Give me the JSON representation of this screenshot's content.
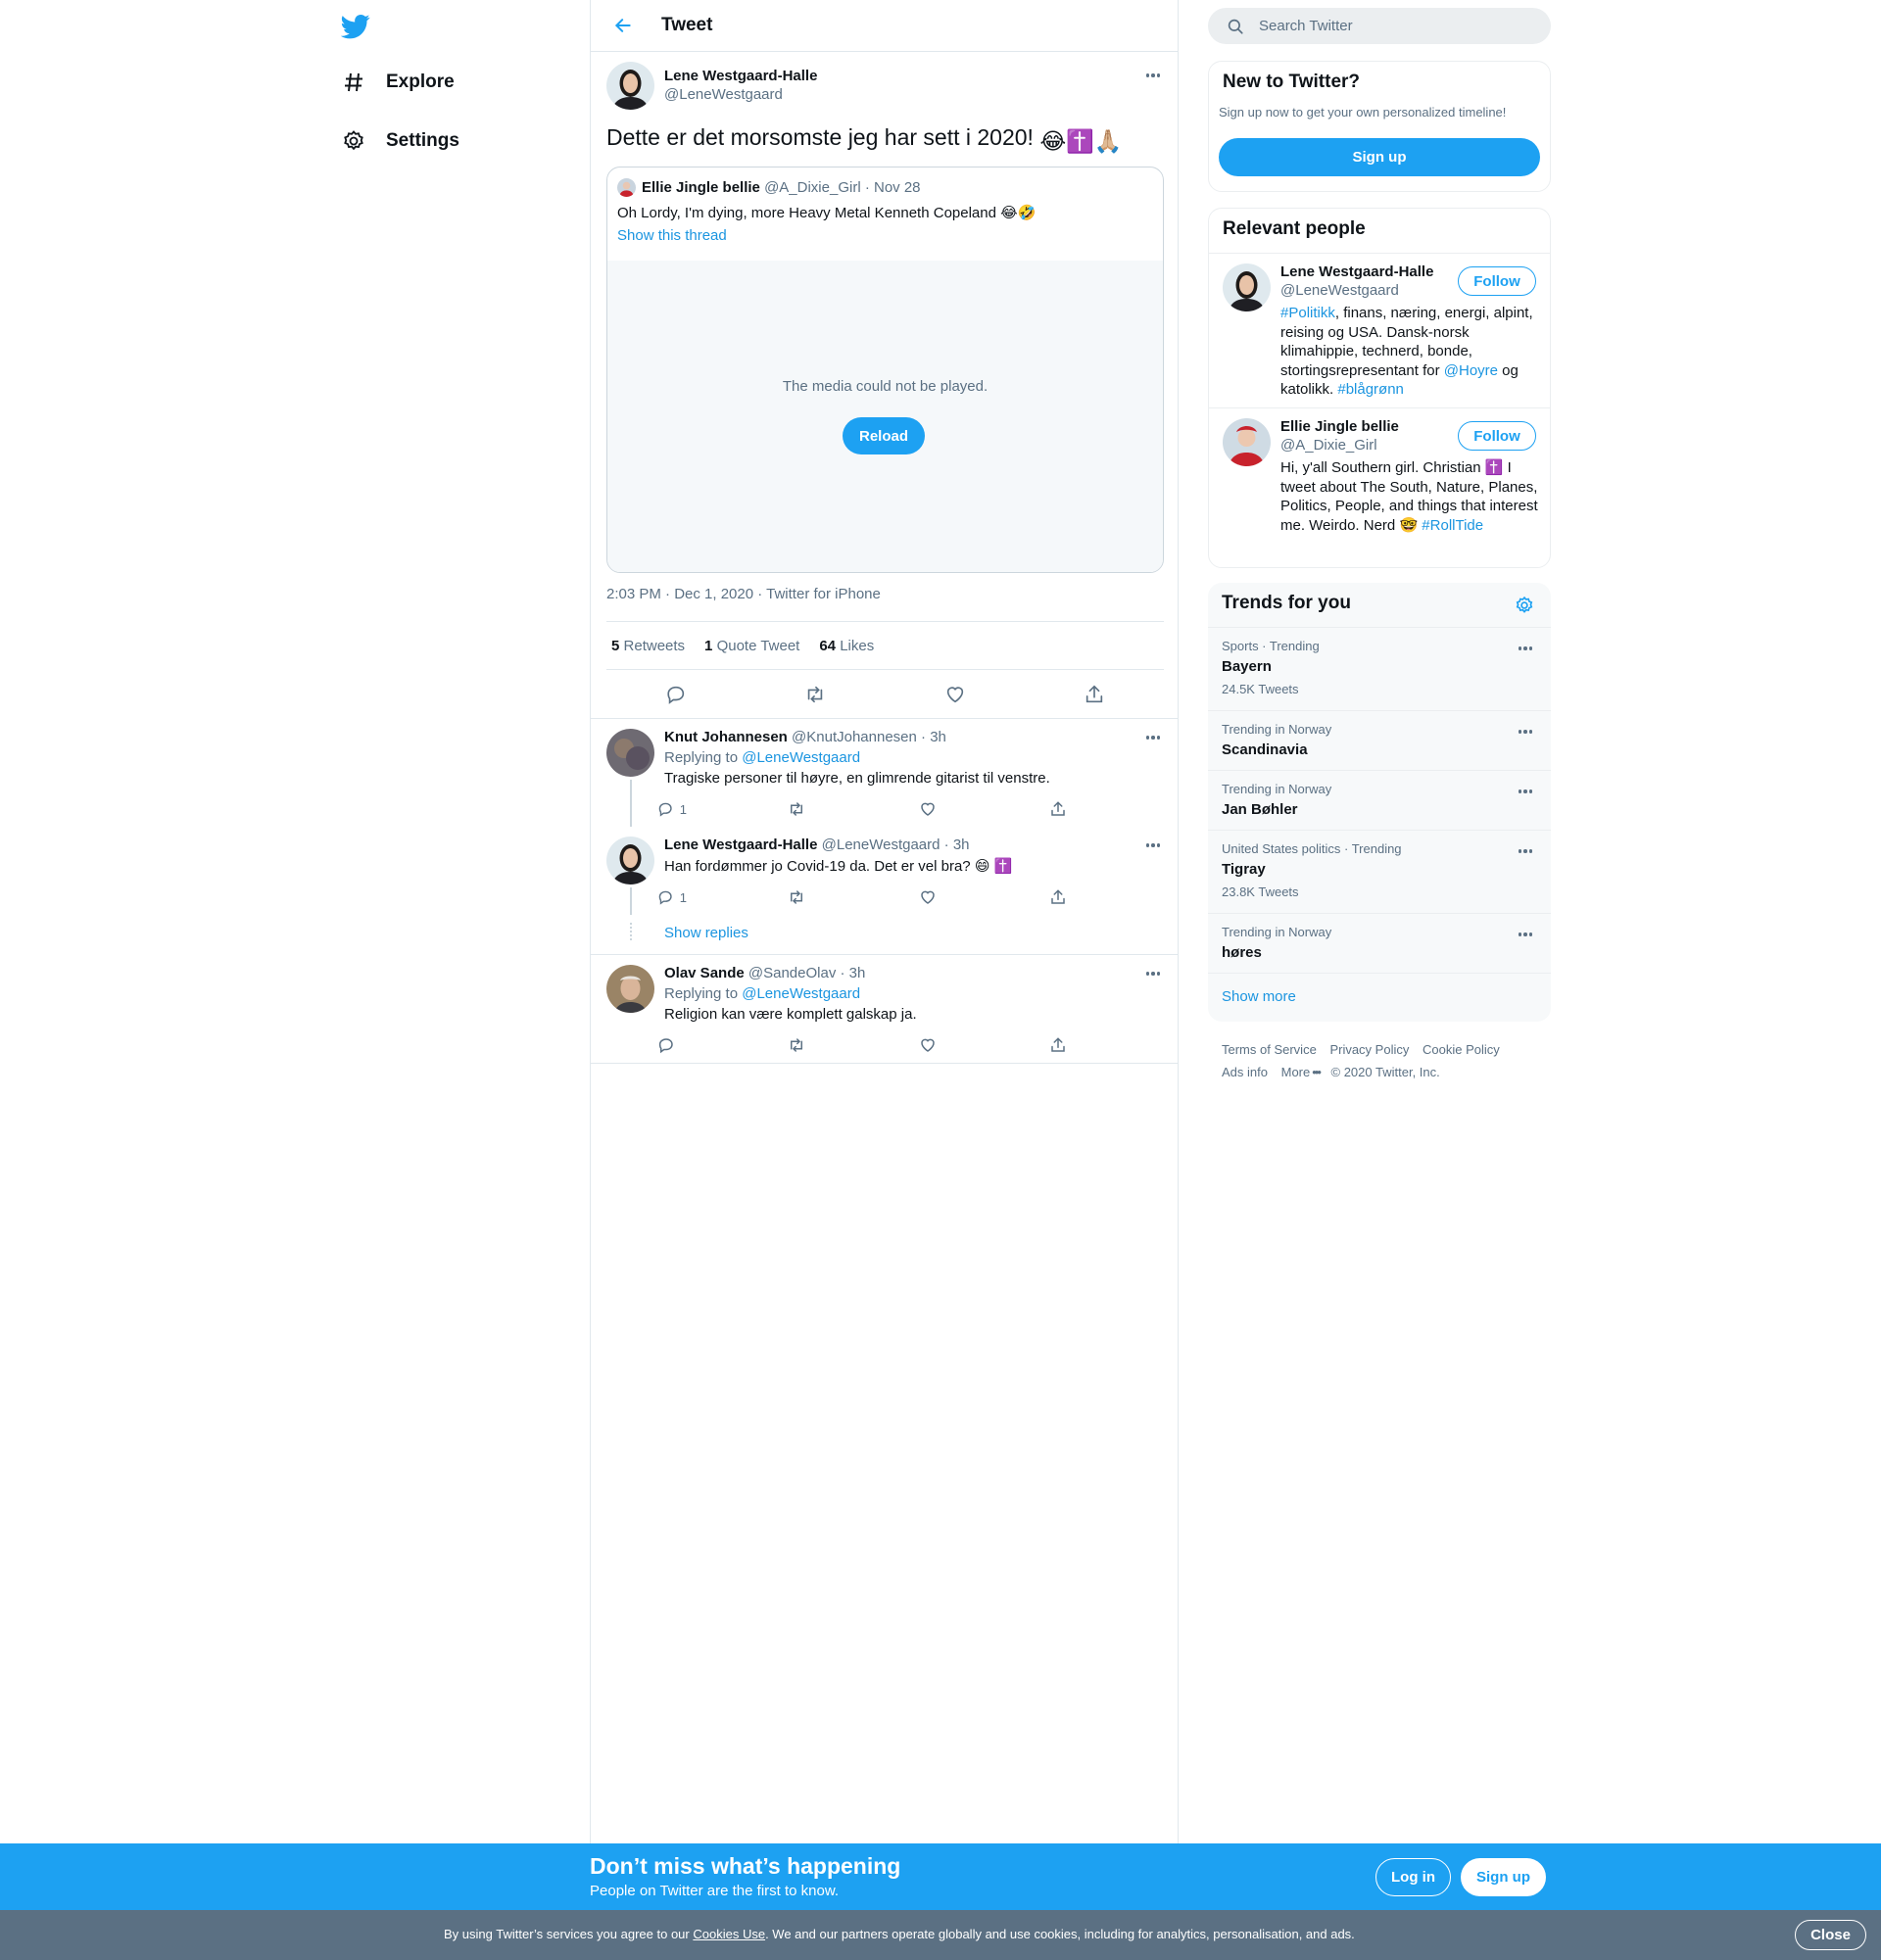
{
  "colors": {
    "accent": "#1da1f2",
    "link": "#1b95e0",
    "muted": "#5b7083",
    "border": "#e1e8ed"
  },
  "nav": {
    "logo_icon": "twitter-bird-icon",
    "items": [
      {
        "label": "Explore",
        "icon": "hashtag-icon"
      },
      {
        "label": "Settings",
        "icon": "gear-icon"
      }
    ]
  },
  "header": {
    "title": "Tweet"
  },
  "tweet": {
    "author_name": "Lene Westgaard-Halle",
    "author_handle": "@LeneWestgaard",
    "text": "Dette er det morsomste jeg har sett i 2020!",
    "text_emojis": [
      "😂",
      "✝️",
      "🙏🏼"
    ],
    "quote": {
      "name": "Ellie Jingle bellie",
      "handle": "@A_Dixie_Girl",
      "date": "· Nov 28",
      "text": "Oh Lordy, I'm dying, more Heavy Metal Kenneth Copeland",
      "text_emojis": [
        "😂",
        "🤣"
      ],
      "thread_link": "Show this thread",
      "media_message": "The media could not be played.",
      "reload_label": "Reload"
    },
    "meta": "2:03 PM · Dec 1, 2020 · Twitter for iPhone",
    "stats": {
      "retweets_count": "5",
      "retweets_label": "Retweets",
      "quotes_count": "1",
      "quotes_label": "Quote Tweet",
      "likes_count": "64",
      "likes_label": "Likes"
    }
  },
  "replies": [
    {
      "name": "Knut Johannesen",
      "handle": "@KnutJohannesen",
      "time": "· 3h",
      "replying_prefix": "Replying to",
      "replying_to": "@LeneWestgaard",
      "text": "Tragiske personer til høyre, en glimrende gitarist til venstre.",
      "reply_count": "1"
    },
    {
      "name": "Lene Westgaard-Halle",
      "handle": "@LeneWestgaard",
      "time": "· 3h",
      "text": "Han fordømmer jo Covid-19 da. Det er vel bra?",
      "text_emojis": [
        "😄",
        "✝️"
      ],
      "reply_count": "1",
      "show_replies": "Show replies"
    },
    {
      "name": "Olav Sande",
      "handle": "@SandeOlav",
      "time": "· 3h",
      "replying_prefix": "Replying to",
      "replying_to": "@LeneWestgaard",
      "text": "Religion kan være komplett galskap ja."
    }
  ],
  "sidebar": {
    "search_placeholder": "Search Twitter",
    "new_to": {
      "title": "New to Twitter?",
      "subtitle": "Sign up now to get your own personalized timeline!",
      "signup_label": "Sign up"
    },
    "relevant": {
      "title": "Relevant people",
      "follow_label": "Follow",
      "people": [
        {
          "name": "Lene Westgaard-Halle",
          "handle": "@LeneWestgaard",
          "bio_tag1": "#Politikk",
          "bio_text1": ", finans, næring, energi, alpint, reising og USA. Dansk-norsk klimahippie, technerd, bonde, stortingsrepresentant for ",
          "bio_mention": "@Hoyre",
          "bio_text2": " og katolikk. ",
          "bio_tag2": "#blågrønn"
        },
        {
          "name": "Ellie Jingle bellie",
          "handle": "@A_Dixie_Girl",
          "bio_text1": "Hi, y'all Southern girl. Christian",
          "bio_emoji1": "✝️",
          "bio_text2": " I tweet about The South, Nature, Planes, Politics, People, and things that interest me. Weirdo. Nerd",
          "bio_emoji2": "🤓",
          "bio_tag": "#RollTide"
        }
      ]
    },
    "trends": {
      "title": "Trends for you",
      "items": [
        {
          "context": "Sports · Trending",
          "name": "Bayern",
          "count": "24.5K Tweets"
        },
        {
          "context": "Trending in Norway",
          "name": "Scandinavia",
          "count": ""
        },
        {
          "context": "Trending in Norway",
          "name": "Jan Bøhler",
          "count": ""
        },
        {
          "context": "United States politics · Trending",
          "name": "Tigray",
          "count": "23.8K Tweets"
        },
        {
          "context": "Trending in Norway",
          "name": "høres",
          "count": ""
        }
      ],
      "show_more": "Show more"
    },
    "footer": {
      "links": [
        "Terms of Service",
        "Privacy Policy",
        "Cookie Policy",
        "Ads info",
        "More"
      ],
      "copyright": "© 2020 Twitter, Inc."
    }
  },
  "banner": {
    "title": "Don’t miss what’s happening",
    "subtitle": "People on Twitter are the first to know.",
    "login_label": "Log in",
    "signup_label": "Sign up"
  },
  "cookie": {
    "text_before": "By using Twitter’s services you agree to our ",
    "link": "Cookies Use",
    "text_after": ". We and our partners operate globally and use cookies, including for analytics, personalisation, and ads.",
    "close_label": "Close"
  }
}
